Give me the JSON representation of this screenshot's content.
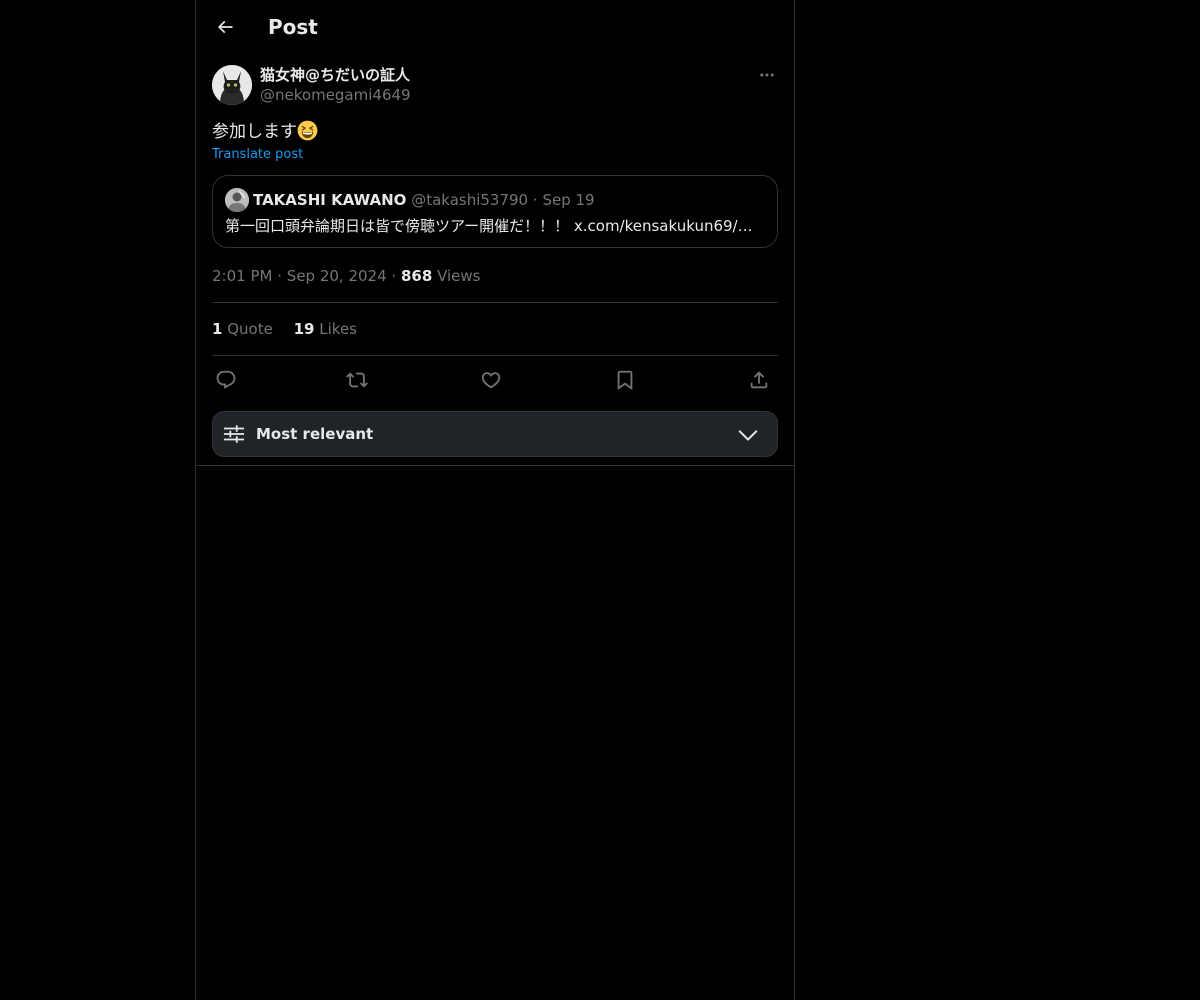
{
  "header": {
    "title": "Post",
    "back_icon": "arrow-left-icon"
  },
  "post": {
    "author": {
      "display_name": "猫女神@ちだいの証人",
      "handle": "@nekomegami4649",
      "avatar_icon": "cat-avatar"
    },
    "more_icon": "more-horizontal-icon",
    "text": "参加します",
    "emoji": "grinning-squinting-face-emoji",
    "translate_label": "Translate post",
    "quote": {
      "display_name": "TAKASHI KAWANO",
      "handle": "@takashi53790",
      "separator": "·",
      "date": "Sep 19",
      "text": "第一回口頭弁論期日は皆で傍聴ツアー開催だ！！！ x.com/kensakukun69/s…"
    },
    "time": "2:01 PM",
    "date": "Sep 20, 2024",
    "separator": "·",
    "views_count": "868",
    "views_label": "Views"
  },
  "stats": {
    "quotes_count": "1",
    "quotes_label": "Quote",
    "likes_count": "19",
    "likes_label": "Likes"
  },
  "actions": [
    {
      "name": "reply",
      "icon": "reply-icon"
    },
    {
      "name": "repost",
      "icon": "repost-icon"
    },
    {
      "name": "like",
      "icon": "heart-icon"
    },
    {
      "name": "bookmark",
      "icon": "bookmark-icon"
    },
    {
      "name": "share",
      "icon": "share-icon"
    }
  ],
  "sort": {
    "label": "Most relevant",
    "icon": "sliders-icon",
    "chevron_icon": "chevron-down-icon"
  },
  "colors": {
    "background": "#000000",
    "border": "#2f3336",
    "text_primary": "#e7e9ea",
    "text_secondary": "#71767b",
    "link": "#1d9bf0",
    "sort_bar_bg": "#202327"
  }
}
